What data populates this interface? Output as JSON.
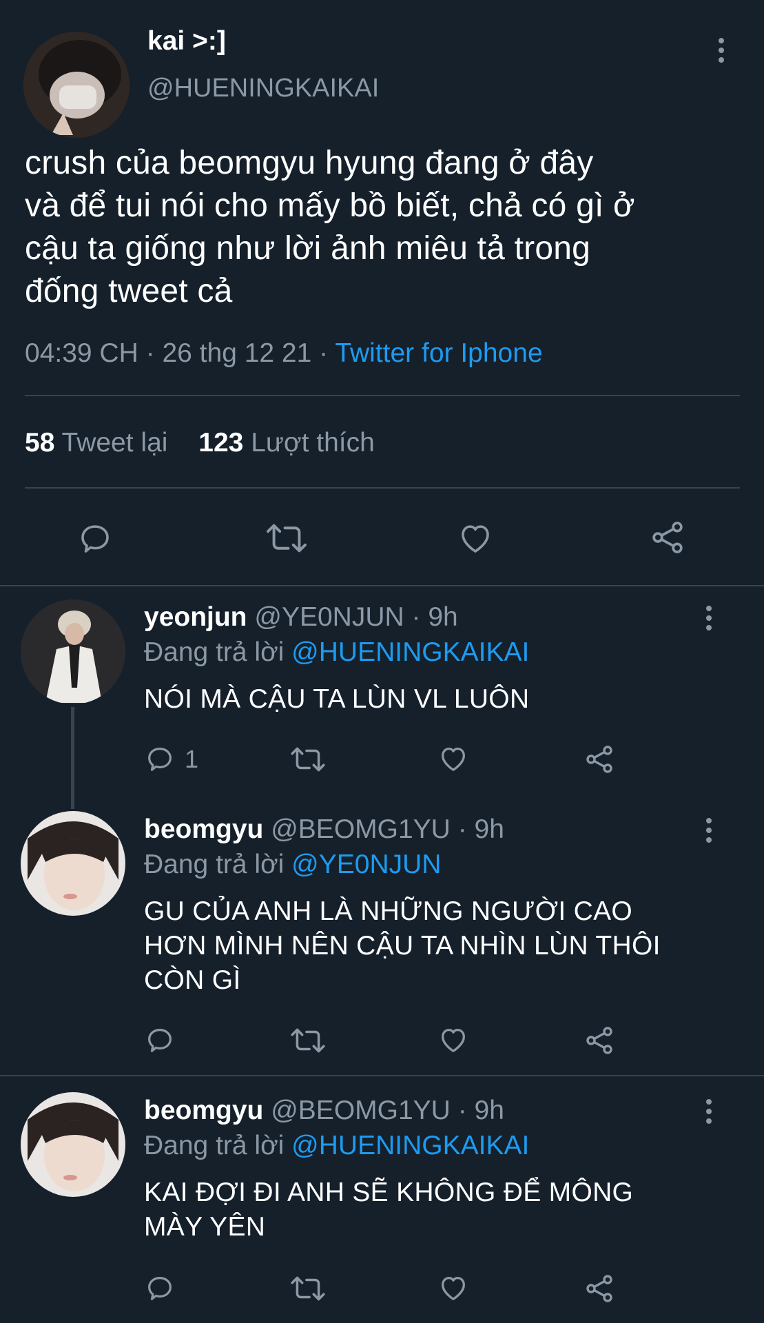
{
  "main_tweet": {
    "display_name": "kai >:]",
    "handle": "@HUENINGKAIKAI",
    "text_lines": [
      "crush của beomgyu hyung đang ở đây",
      "và để tui nói cho mấy bồ biết, chả có gì ở",
      "cậu ta giống như lời ảnh miêu tả trong",
      "đống tweet cả"
    ],
    "time": "04:39 CH",
    "dot": "·",
    "date": "26 thg 12 21",
    "source": "Twitter for Iphone",
    "retweet_count": "58",
    "retweet_label": "Tweet lại",
    "like_count": "123",
    "like_label": "Lượt thích"
  },
  "replies": [
    {
      "display_name": "yeonjun",
      "handle": "@YE0NJUN",
      "time": "· 9h",
      "replying_label": "Đang trả lời",
      "replying_to": "@HUENINGKAIKAI",
      "text_lines": [
        "NÓI MÀ CẬU TA LÙN VL LUÔN"
      ],
      "reply_count": "1"
    },
    {
      "display_name": "beomgyu",
      "handle": "@BEOMG1YU",
      "time": "· 9h",
      "replying_label": "Đang trả lời",
      "replying_to": "@YE0NJUN",
      "text_lines": [
        "GU CỦA ANH LÀ NHỮNG NGƯỜI CAO",
        "HƠN MÌNH NÊN CẬU TA NHÌN LÙN THÔI",
        "CÒN GÌ"
      ],
      "reply_count": ""
    },
    {
      "display_name": "beomgyu",
      "handle": "@BEOMG1YU",
      "time": "· 9h",
      "replying_label": "Đang trả lời",
      "replying_to": "@HUENINGKAIKAI",
      "text_lines": [
        "KAI ĐỢI ĐI ANH SẼ KHÔNG ĐỂ MÔNG",
        "MÀY YÊN"
      ],
      "reply_count": ""
    }
  ],
  "colors": {
    "background": "#15202b",
    "text": "#ffffff",
    "muted": "#8b98a5",
    "link": "#1d9bf0",
    "divider": "#38444d"
  },
  "icons": [
    "more-vertical-icon",
    "reply-icon",
    "retweet-icon",
    "like-icon",
    "share-icon"
  ]
}
